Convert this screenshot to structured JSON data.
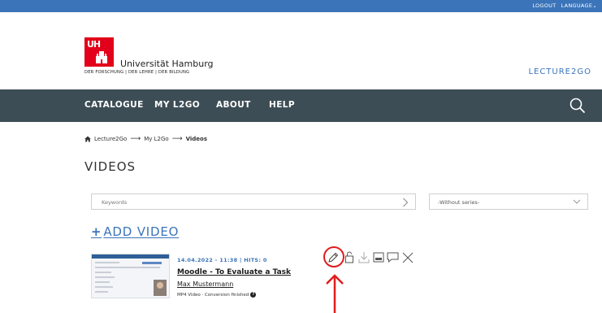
{
  "topbar": {
    "logout": "LOGOUT",
    "language": "LANGUAGE"
  },
  "logo": {
    "mark_text": "UH",
    "name": "Universität Hamburg",
    "tagline": "DER FORSCHUNG | DER LEHRE | DER BILDUNG"
  },
  "brand": "LECTURE2GO",
  "nav": {
    "items": [
      "CATALOGUE",
      "MY L2GO",
      "ABOUT",
      "HELP"
    ]
  },
  "breadcrumb": {
    "items": [
      "Lecture2Go",
      "My L2Go",
      "Videos"
    ],
    "separator": "⟶"
  },
  "page_title": "VIDEOS",
  "filters": {
    "keywords_placeholder": "Keywords",
    "series_value": "-Without series-"
  },
  "add_video": {
    "plus": "+",
    "label": "ADD VIDEO"
  },
  "video": {
    "meta": "14.04.2022 - 11:38 | HITS: 0",
    "title": "Moodle - To Evaluate a Task",
    "author": "Max Mustermann",
    "status": "MP4 Video · Conversion finished",
    "help_glyph": "?"
  },
  "actions": [
    "edit-icon",
    "lock-icon",
    "download-icon",
    "image-icon",
    "comment-icon",
    "delete-icon"
  ],
  "colors": {
    "accent": "#3b74b9",
    "nav_bg": "#3d4d56",
    "logo_red": "#e2001a",
    "highlight": "#e21b1b"
  }
}
